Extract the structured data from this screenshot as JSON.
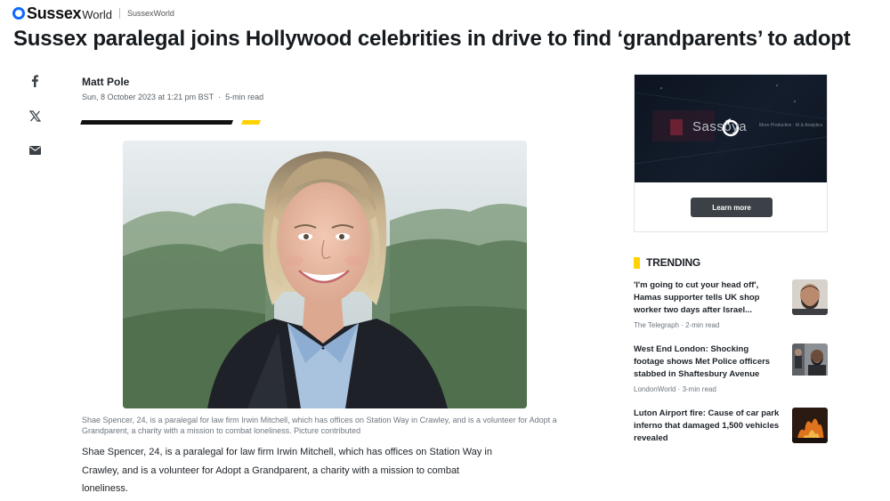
{
  "header": {
    "brand_name": "Sussex",
    "brand_suffix": "World",
    "provider": "SussexWorld"
  },
  "article": {
    "headline": "Sussex paralegal joins Hollywood celebrities in drive to find ‘grandparents’ to adopt",
    "author": "Matt Pole",
    "date": "Sun, 8 October 2023 at 1:21 pm BST",
    "read_time": "5-min read",
    "caption": "Shae Spencer, 24, is a paralegal for law firm Irwin Mitchell, which has offices on Station Way in Crawley, and is a volunteer for Adopt a Grandparent, a charity with a mission to combat loneliness. Picture contributed",
    "body": "Shae Spencer, 24, is a paralegal for law firm Irwin Mitchell, which has offices on Station Way in Crawley, and is a volunteer for Adopt a Grandparent, a charity with a mission to combat loneliness."
  },
  "share": {
    "icons": [
      "facebook-icon",
      "x-icon",
      "mail-icon"
    ]
  },
  "ad": {
    "brand": "Sassoya",
    "tagline": "More Productive · AI & Analytics",
    "button_label": "Learn more"
  },
  "trending": {
    "title": "TRENDING",
    "items": [
      {
        "headline": "'I'm going to cut your head off', Hamas supporter tells UK shop worker two days after Israel...",
        "source": "The Telegraph",
        "read_time": "2-min read"
      },
      {
        "headline": "West End London: Shocking footage shows Met Police officers stabbed in Shaftesbury Avenue",
        "source": "LondonWorld",
        "read_time": "3-min read"
      },
      {
        "headline": "Luton Airport fire: Cause of car park inferno that damaged 1,500 vehicles revealed",
        "source": "",
        "read_time": ""
      }
    ]
  },
  "colors": {
    "accent_yellow": "#ffd200",
    "brand_blue": "#0f69ff",
    "text_dark": "#1d2228"
  }
}
